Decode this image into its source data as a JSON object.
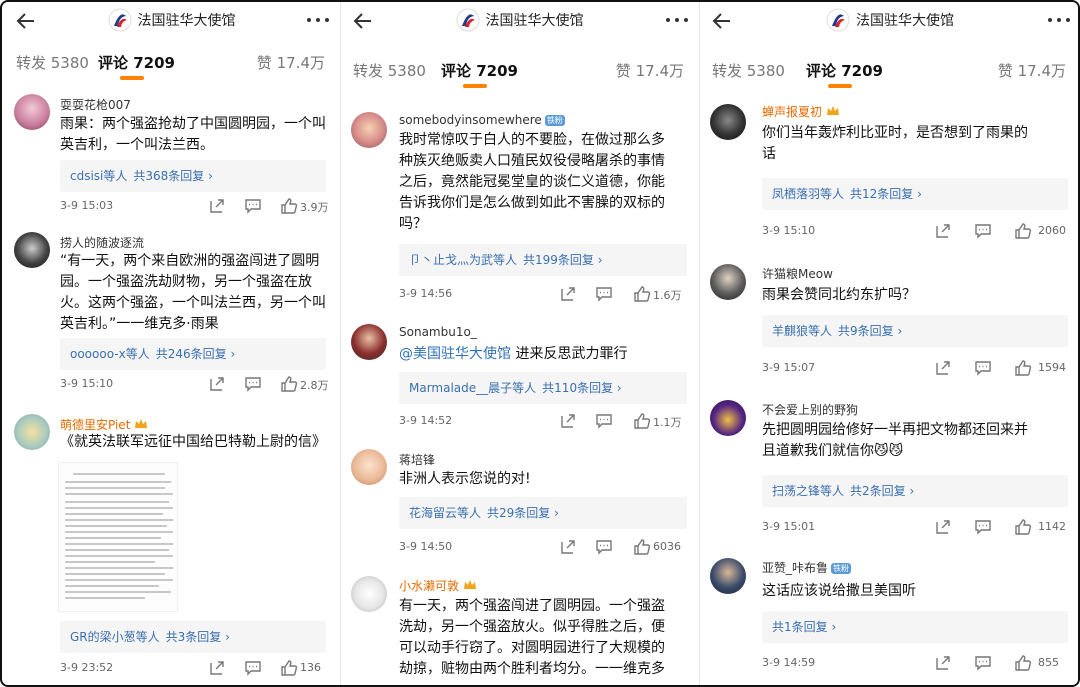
{
  "header": {
    "account_name": "法国驻华大使馆"
  },
  "tabs": {
    "reposts": "转发 5380",
    "comments": "评论 7209",
    "likes": "赞 17.4万",
    "accent_color": "#ff8200"
  },
  "panels": [
    {
      "comments": [
        {
          "username": "耍耍花枪007",
          "text_lines": [
            "雨果：两个强盗抢劫了中国圆明园，一个叫",
            "英吉利，一个叫法兰西。"
          ],
          "reply_user": "cdsisi等人",
          "reply_count": "共368条回复 ›",
          "time": "3-9 15:03",
          "likes": "3.9万"
        },
        {
          "username": "捞人的随波逐流",
          "text_lines": [
            "“有一天，两个来自欧洲的强盗闯进了圆明",
            "园。一个强盗洗劫财物，另一个强盗在放",
            "火。这两个强盗，一个叫法兰西，另一个叫",
            "英吉利。”一一维克多·雨果"
          ],
          "reply_user": "oooooo-x等人",
          "reply_count": "共246条回复 ›",
          "time": "3-9 15:10",
          "likes": "2.8万"
        },
        {
          "username": "萌德里安Piet",
          "text_lines": [
            "《就英法联军远征中国给巴特勒上尉的信》"
          ],
          "reply_user": "GR的梁小葱等人",
          "reply_count": "共3条回复 ›",
          "time": "3-9 23:52",
          "likes": "136"
        }
      ]
    },
    {
      "comments": [
        {
          "username": "somebodyinsomewhere",
          "badge": "铁粉",
          "text_lines": [
            "我时常惊叹于白人的不要脸，在做过那么多",
            "种族灭绝贩卖人口殖民奴役侵略屠杀的事情",
            "之后，竟然能冠冕堂皇的谈仁义道德，你能",
            "告诉我你们是怎么做到如此不害臊的双标的",
            "吗？"
          ],
          "reply_user": "卩丶止戈灬为武等人",
          "reply_count": "共199条回复 ›",
          "time": "3-9 14:56",
          "likes": "1.6万"
        },
        {
          "username": "Sonambu1o_",
          "mention": "@美国驻华大使馆",
          "text_lines": [
            " 进来反思武力罪行"
          ],
          "reply_user": "Marmalade__晨子等人",
          "reply_count": "共110条回复 ›",
          "time": "3-9 14:52",
          "likes": "1.1万"
        },
        {
          "username": "蒋培锋",
          "text_lines": [
            "非洲人表示您说的对!"
          ],
          "reply_user": "花海留云等人",
          "reply_count": "共29条回复 ›",
          "time": "3-9 14:50",
          "likes": "6036"
        },
        {
          "username": "小水濑可敦",
          "text_lines": [
            "有一天，两个强盗闯进了圆明园。一个强盗",
            "洗劫，另一个强盗放火。似乎得胜之后，便",
            "可以动手行窃了。对圆明园进行了大规模的",
            "劫掠，赃物由两个胜利者均分。一一维克多"
          ]
        }
      ]
    },
    {
      "comments": [
        {
          "username": "蝉声报夏初",
          "text_lines": [
            "你们当年轰炸利比亚时，是否想到了雨果的",
            "话"
          ],
          "reply_user": "凤栖落羽等人",
          "reply_count": "共12条回复 ›",
          "time": "3-9 15:10",
          "likes": "2060"
        },
        {
          "username": "许猫粮Meow",
          "text_lines": [
            "雨果会赞同北约东扩吗？"
          ],
          "reply_user": "羊麒狼等人",
          "reply_count": "共9条回复 ›",
          "time": "3-9 15:07",
          "likes": "1594"
        },
        {
          "username": "不会爱上别的野狗",
          "text_lines": [
            "先把圆明园给修好一半再把文物都还回来并",
            "且道歉我们就信你😼😼"
          ],
          "reply_user": "扫荡之锋等人",
          "reply_count": "共2条回复 ›",
          "time": "3-9 15:01",
          "likes": "1142"
        },
        {
          "username": "亚赞_咔布鲁",
          "badge": "铁粉",
          "text_lines": [
            "这话应该说给撒旦美国听"
          ],
          "reply_user": "",
          "reply_count": "共1条回复 ›",
          "time": "3-9 14:59",
          "likes": "855"
        }
      ]
    }
  ]
}
